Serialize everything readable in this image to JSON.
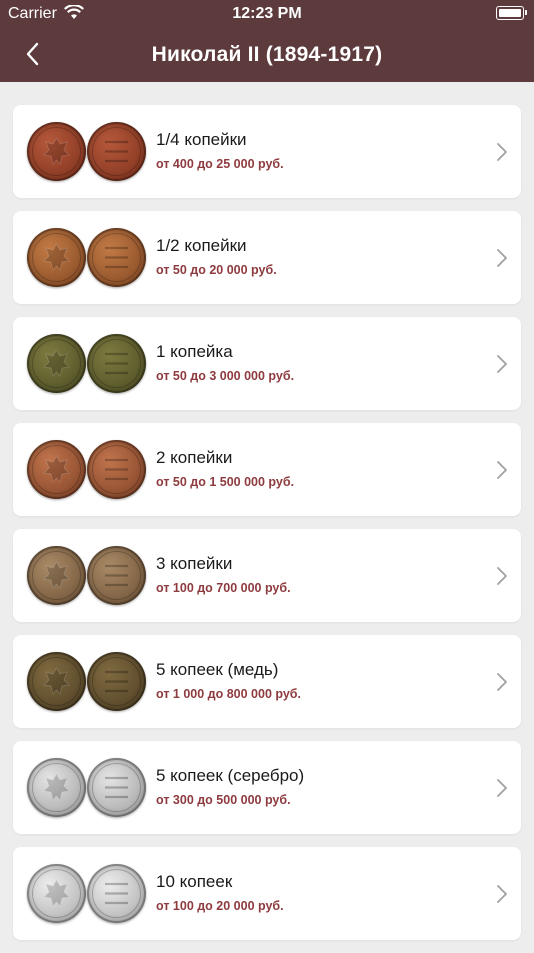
{
  "status_bar": {
    "carrier": "Carrier",
    "time": "12:23 PM",
    "icons": [
      "wifi-icon",
      "battery-icon"
    ]
  },
  "nav": {
    "title": "Николай II (1894-1917)",
    "back_icon": "chevron-left-icon"
  },
  "colors": {
    "nav_background": "#5d3b3d",
    "price_text": "#8e3b3f",
    "page_background": "#ededed"
  },
  "coins": [
    {
      "title": "1/4 копейки",
      "price": "от 400 до 25 000 руб.",
      "metal": "copper-red",
      "colors": [
        "#b5583a",
        "#7a2f1c"
      ]
    },
    {
      "title": "1/2 копейки",
      "price": "от 50 до 20 000 руб.",
      "metal": "copper",
      "colors": [
        "#c27a45",
        "#7e4420"
      ]
    },
    {
      "title": "1 копейка",
      "price": "от 50 до 3 000 000 руб.",
      "metal": "copper-green",
      "colors": [
        "#7d7a3f",
        "#4a4a22"
      ]
    },
    {
      "title": "2 копейки",
      "price": "от 50 до 1 500 000 руб.",
      "metal": "copper",
      "colors": [
        "#c0744c",
        "#7b3e24"
      ]
    },
    {
      "title": "3 копейки",
      "price": "от 100 до 700 000 руб.",
      "metal": "copper-brown",
      "colors": [
        "#a98a66",
        "#6a4e33"
      ]
    },
    {
      "title": "5 копеек (медь)",
      "price": "от 1 000 до 800 000 руб.",
      "metal": "copper-dark",
      "colors": [
        "#7f6a40",
        "#4c3c22"
      ]
    },
    {
      "title": "5 копеек (серебро)",
      "price": "от 300 до 500 000 руб.",
      "metal": "silver",
      "colors": [
        "#e4e4e4",
        "#9a9a9a"
      ]
    },
    {
      "title": "10 копеек",
      "price": "от 100 до 20 000 руб.",
      "metal": "silver",
      "colors": [
        "#ececec",
        "#a6a6a6"
      ]
    }
  ]
}
